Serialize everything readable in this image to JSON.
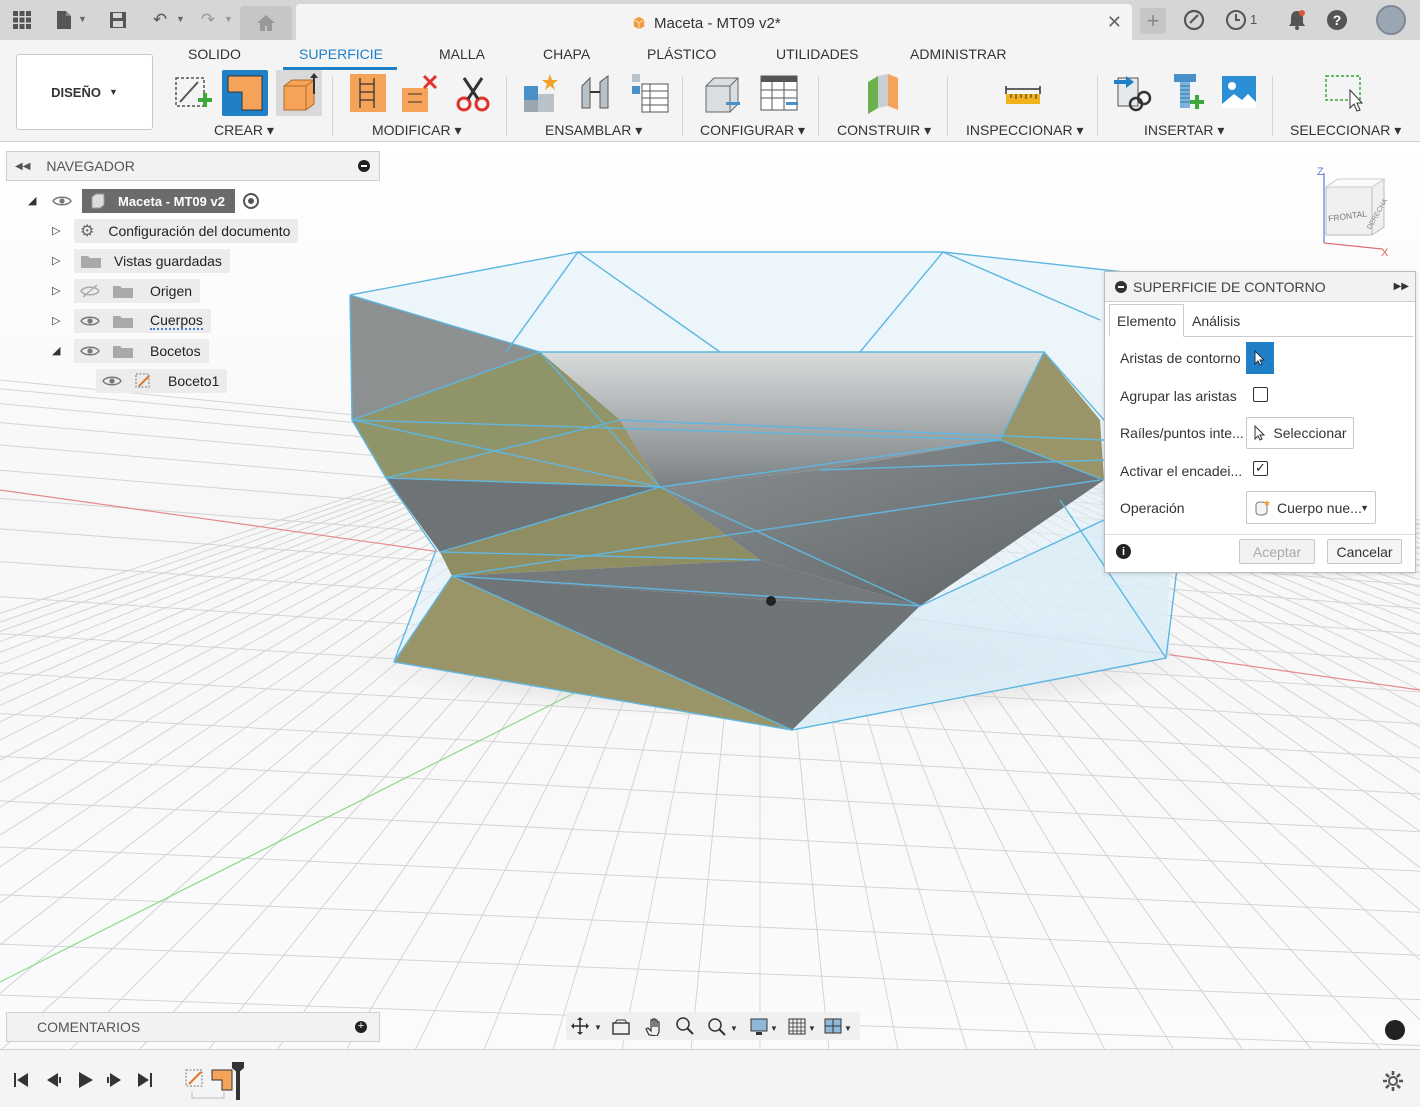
{
  "window": {
    "document_title": "Maceta - MT09 v2*",
    "job_count": "1"
  },
  "toolbar": {
    "workspace": "DISEÑO",
    "tabs": [
      "SOLIDO",
      "SUPERFICIE",
      "MALLA",
      "CHAPA",
      "PLÁSTICO",
      "UTILIDADES",
      "ADMINISTRAR"
    ],
    "active_tab": "SUPERFICIE",
    "groups": [
      "CREAR",
      "MODIFICAR",
      "ENSAMBLAR",
      "CONFIGURAR",
      "CONSTRUIR",
      "INSPECCIONAR",
      "INSERTAR",
      "SELECCIONAR"
    ]
  },
  "browser": {
    "title": "NAVEGADOR",
    "root": "Maceta - MT09 v2",
    "items": [
      "Configuración del documento",
      "Vistas guardadas",
      "Origen",
      "Cuerpos",
      "Bocetos",
      "Boceto1"
    ]
  },
  "viewcube": {
    "face": "FRONTAL",
    "side": "DERECHA",
    "axis_z": "Z",
    "axis_x": "X"
  },
  "dialog": {
    "title": "SUPERFICIE DE CONTORNO",
    "tabs": [
      "Elemento",
      "Análisis"
    ],
    "rows": {
      "boundary_edges": "Aristas de contorno",
      "group_edges": "Agrupar las aristas",
      "rails": "Raíles/puntos inte...",
      "chaining": "Activar el encadei...",
      "operation": "Operación"
    },
    "select_label": "Seleccionar",
    "operation_value": "Cuerpo nue...",
    "group_edges_checked": false,
    "chaining_checked": true,
    "ok_label": "Aceptar",
    "cancel_label": "Cancelar"
  },
  "comments": {
    "title": "COMENTARIOS"
  },
  "colors": {
    "accent": "#1f7fc7",
    "surface_olive": "#9a9568",
    "surface_grey": "#7f8587",
    "edge_blue": "#5fb6e0",
    "tool_orange": "#f6a35a"
  }
}
